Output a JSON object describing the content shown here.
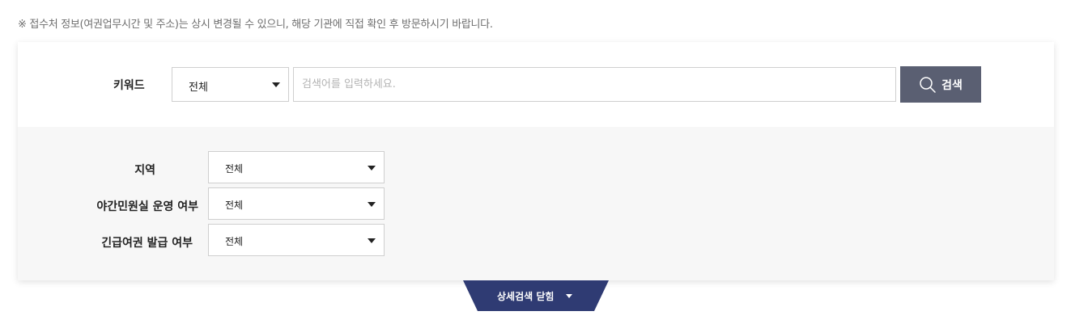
{
  "notice": "※ 접수처 정보(여권업무시간 및 주소)는 상시 변경될 수 있으니, 해당 기관에 직접 확인 후 방문하시기 바랍니다.",
  "keyword": {
    "label": "키워드",
    "scope_selected": "전체",
    "placeholder": "검색어를 입력하세요.",
    "value": "",
    "search_button_label": "검색",
    "search_icon": "search-icon"
  },
  "filters": {
    "region": {
      "label": "지역",
      "selected": "전체"
    },
    "night_office": {
      "label": "야간민원실 운영 여부",
      "selected": "전체"
    },
    "urgent_passport": {
      "label": "긴급여권 발급 여부",
      "selected": "전체"
    }
  },
  "toggle": {
    "label": "상세검색 닫힘",
    "icon": "caret-down-icon"
  },
  "colors": {
    "search_button": "#5a5f72",
    "toggle_tab": "#2f3b73",
    "filter_background": "#f7f7f7",
    "notice_text": "#6e6e6e"
  }
}
